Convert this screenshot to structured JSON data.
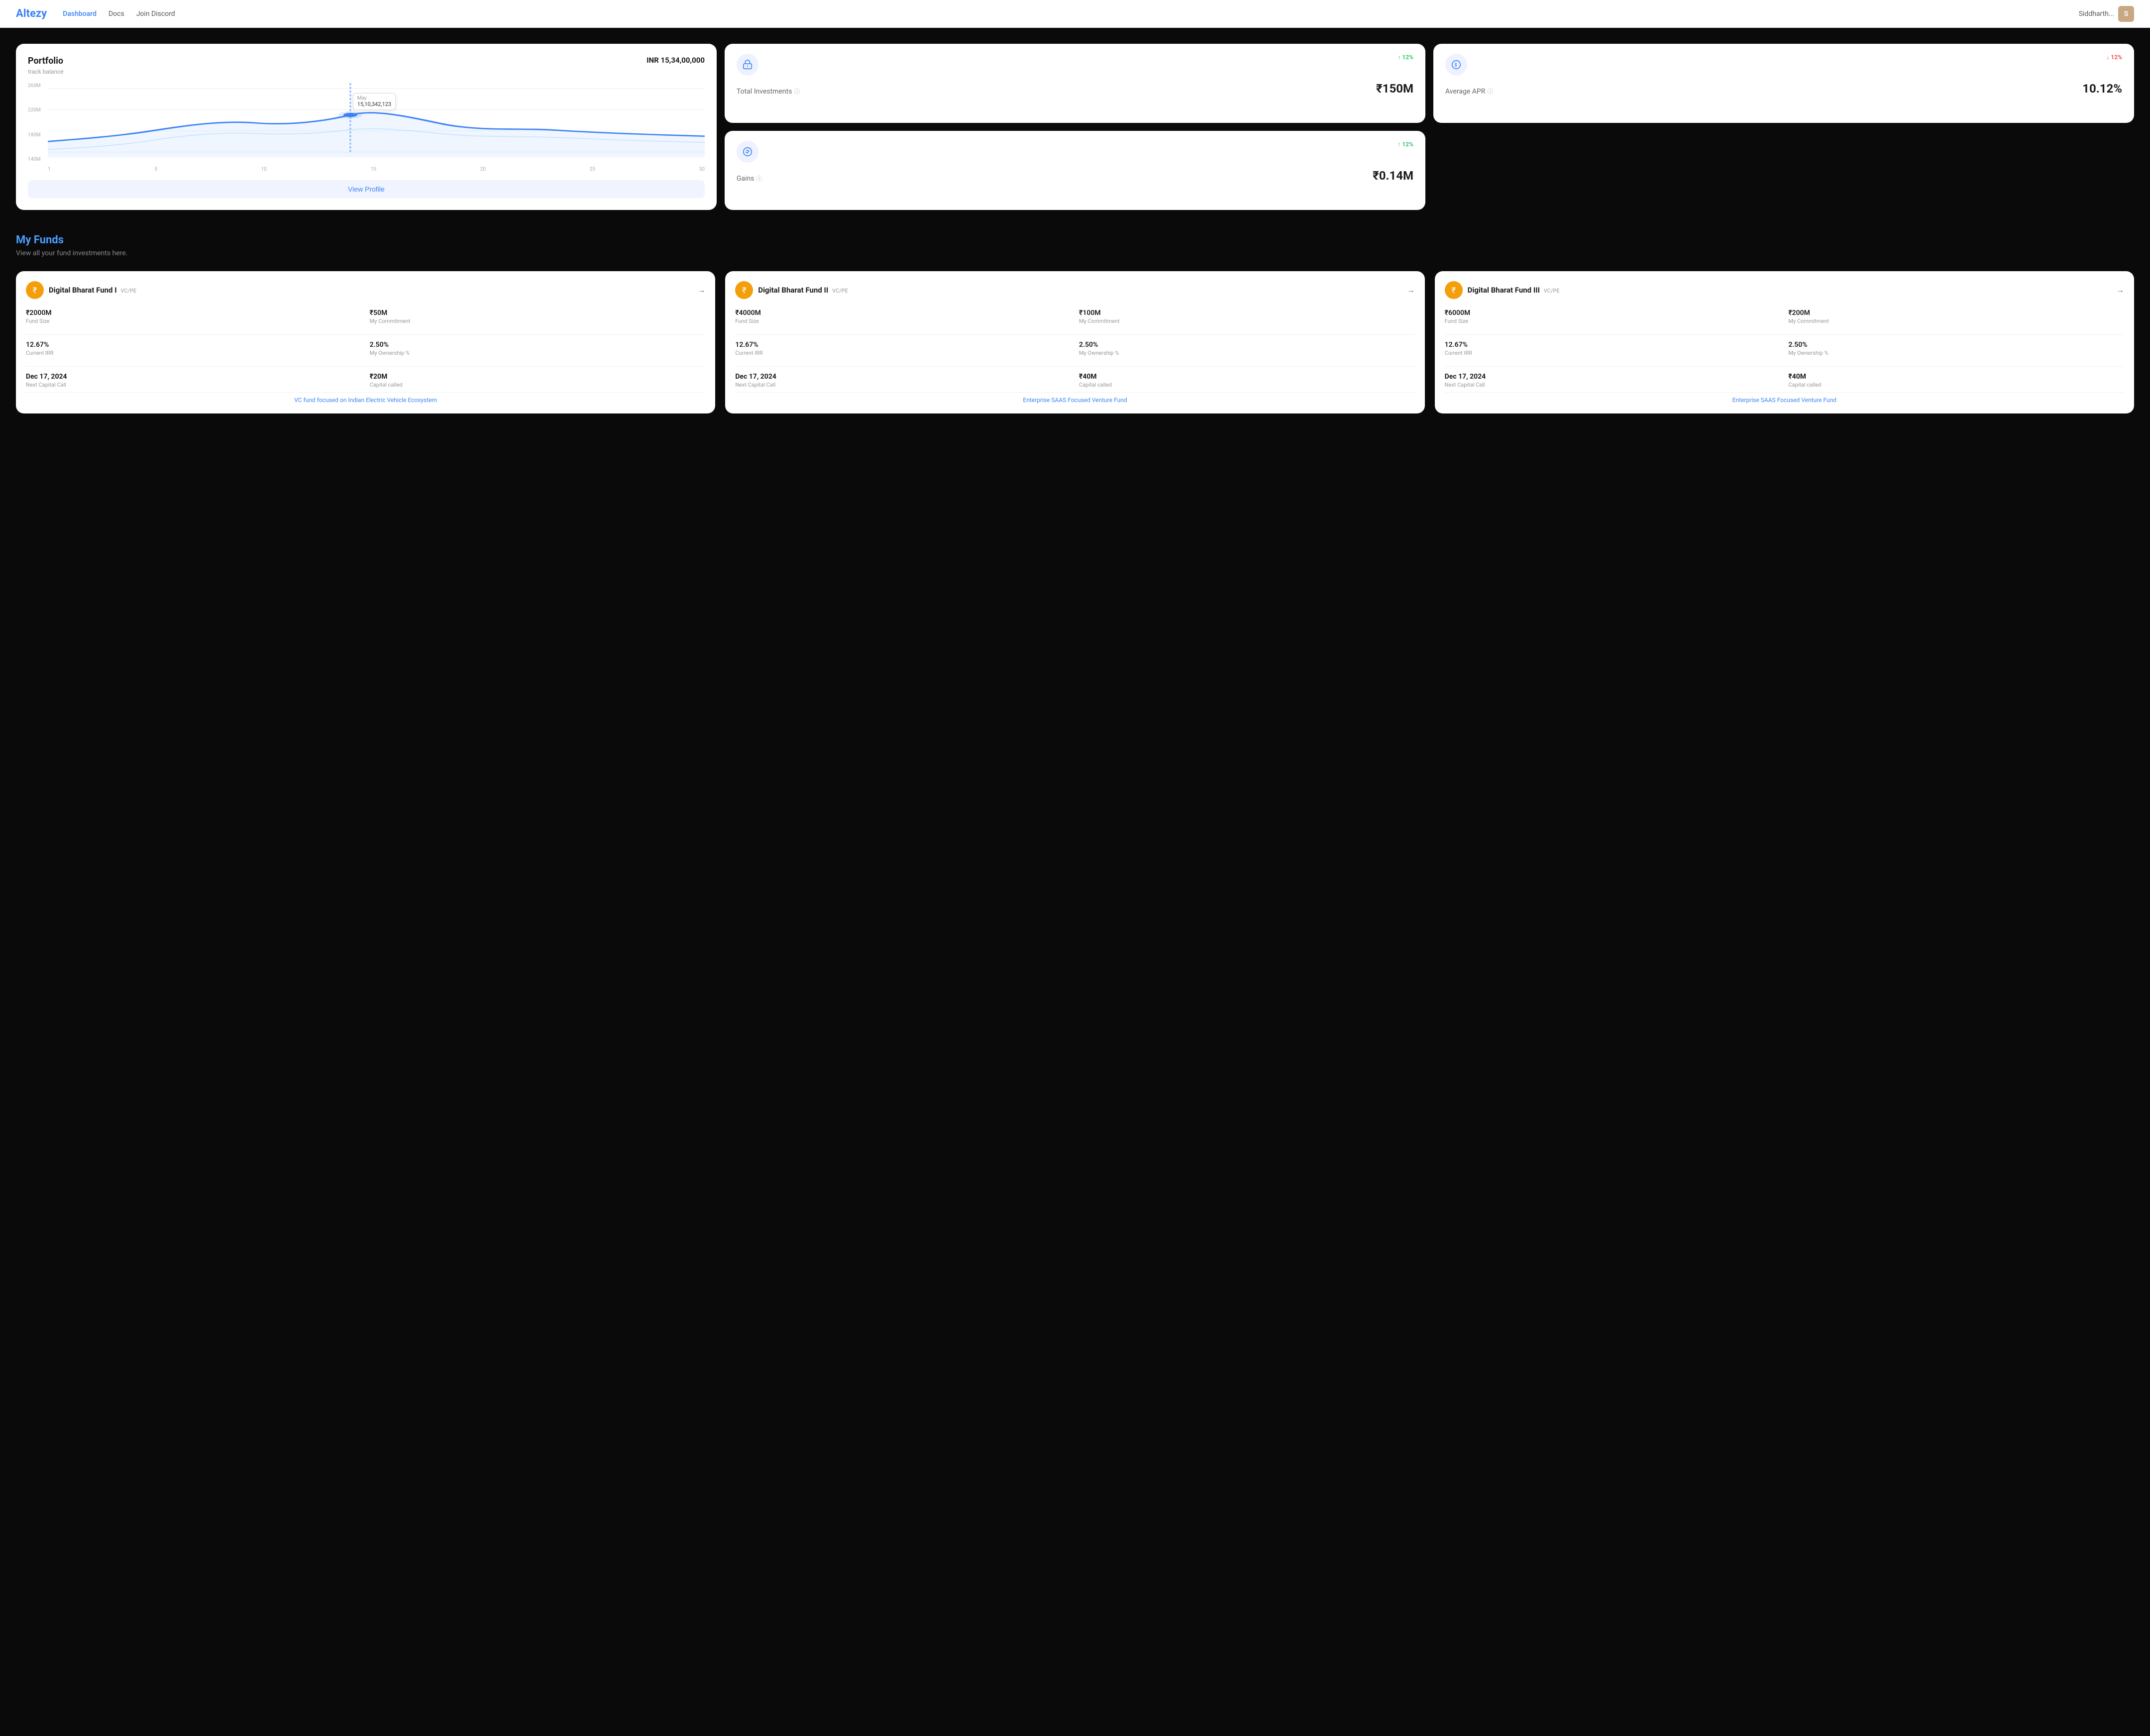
{
  "nav": {
    "logo_text": "Altezy",
    "logo_color": "Alt",
    "links": [
      {
        "label": "Dashboard",
        "active": true
      },
      {
        "label": "Docs",
        "active": false
      },
      {
        "label": "Join Discord",
        "active": false
      }
    ],
    "username": "Siddharth...",
    "avatar_initials": "S"
  },
  "portfolio": {
    "title": "Portfolio",
    "subtitle": "track balance",
    "amount": "INR 15,34,00,000",
    "tooltip_value": "15,10,342,123",
    "tooltip_label": "May",
    "y_labels": [
      "260M",
      "220M",
      "180M",
      "140M"
    ],
    "x_labels": [
      "1",
      "5",
      "10",
      "15",
      "20",
      "25",
      "30"
    ],
    "view_profile_label": "View Profile"
  },
  "metrics": [
    {
      "id": "total-investments",
      "icon": "🏛",
      "badge": "↑ 12%",
      "badge_type": "up",
      "label": "Total Investments",
      "value": "₹150M"
    },
    {
      "id": "average-apr",
      "icon": "$",
      "badge": "↓ 12%",
      "badge_type": "down",
      "label": "Average APR",
      "value": "10.12%"
    },
    {
      "id": "gains",
      "icon": "⚙",
      "badge": "↑ 12%",
      "badge_type": "up",
      "label": "Gains",
      "value": "₹0.14M"
    }
  ],
  "my_funds": {
    "title": "My Funds",
    "subtitle": "View all your fund investments here."
  },
  "funds": [
    {
      "name": "Digital Bharat Fund I",
      "type": "VC/PE",
      "fund_size": "₹2000M",
      "my_commitment": "₹50M",
      "current_irr": "12.67%",
      "my_ownership": "2.50%",
      "next_capital_call": "Dec 17, 2024",
      "capital_called": "₹20M",
      "description": "VC fund focused on Indian Electric Vehicle Ecosystem"
    },
    {
      "name": "Digital Bharat Fund II",
      "type": "VC/PE",
      "fund_size": "₹4000M",
      "my_commitment": "₹100M",
      "current_irr": "12.67%",
      "my_ownership": "2.50%",
      "next_capital_call": "Dec 17, 2024",
      "capital_called": "₹40M",
      "description": "Enterprise SAAS Focused Venture Fund"
    },
    {
      "name": "Digital Bharat Fund III",
      "type": "VC/PE",
      "fund_size": "₹6000M",
      "my_commitment": "₹200M",
      "current_irr": "12.67%",
      "my_ownership": "2.50%",
      "next_capital_call": "Dec 17, 2024",
      "capital_called": "₹40M",
      "description": "Enterprise SAAS Focused Venture Fund"
    }
  ],
  "labels": {
    "fund_size": "Fund Size",
    "my_commitment": "My Commitment",
    "current_irr": "Current IRR",
    "my_ownership": "My Ownership %",
    "next_capital_call": "Next Capital Call",
    "capital_called": "Capital called"
  }
}
